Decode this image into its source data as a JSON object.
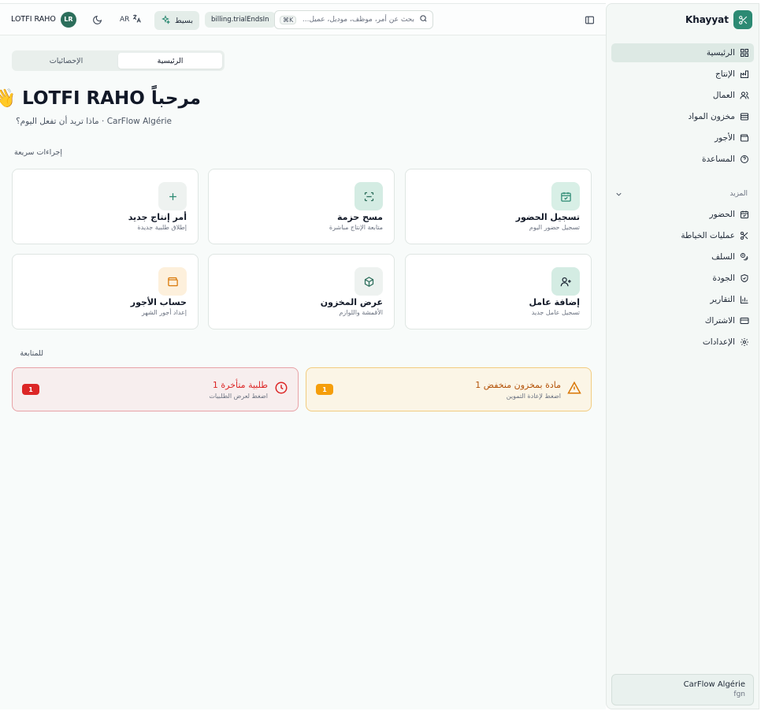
{
  "sidebar": {
    "brand": "Khayyat",
    "items": [
      {
        "label": "الرئيسية",
        "icon": "dashboard-icon",
        "active": true
      },
      {
        "label": "الإنتاج",
        "icon": "factory-icon"
      },
      {
        "label": "العمال",
        "icon": "users-icon"
      },
      {
        "label": "مخزون المواد",
        "icon": "layers-icon"
      },
      {
        "label": "الأجور",
        "icon": "wallet-icon"
      },
      {
        "label": "المساعدة",
        "icon": "help-icon"
      }
    ],
    "group_label": "المزيد",
    "more_items": [
      {
        "label": "الحضور",
        "icon": "calendar-check-icon"
      },
      {
        "label": "عمليات الخياطة",
        "icon": "scissors-icon"
      },
      {
        "label": "السلف",
        "icon": "money-icon"
      },
      {
        "label": "الجودة",
        "icon": "shield-icon"
      },
      {
        "label": "التقارير",
        "icon": "bar-chart-icon"
      },
      {
        "label": "الاشتراك",
        "icon": "credit-card-icon"
      },
      {
        "label": "الإعدادات",
        "icon": "settings-icon"
      }
    ],
    "org": {
      "name": "CarFlow Algérie",
      "sub": "fgn"
    }
  },
  "topbar": {
    "user_name": "LOTFI RAHO",
    "avatar_initials": "LR",
    "lang": "AR",
    "mode_label": "بسيط",
    "billing_label": "billing.trialEndsIn",
    "search_placeholder": "بحث عن أمر، موظف، موديل، عميل...",
    "search_kbd": "⌘K"
  },
  "tabs": [
    {
      "label": "الرئيسية",
      "active": true
    },
    {
      "label": "الإحصائيات",
      "active": false
    }
  ],
  "greeting": {
    "title": "مرحباً LOTFI RAHO 👋",
    "subtitle": "CarFlow Algérie · ماذا تريد أن تفعل اليوم؟"
  },
  "quick_actions": {
    "label": "إجراءات سريعة",
    "cards": [
      {
        "title": "تسجيل الحضور",
        "desc": "تسجيل حضور اليوم",
        "icon": "calendar-check-icon"
      },
      {
        "title": "مسح حزمة",
        "desc": "متابعة الإنتاج مباشرة",
        "icon": "scan-icon"
      },
      {
        "title": "أمر إنتاج جديد",
        "desc": "إطلاق طلبية جديدة",
        "icon": "plus-icon"
      },
      {
        "title": "إضافة عامل",
        "desc": "تسجيل عامل جديد",
        "icon": "user-plus-icon"
      },
      {
        "title": "عرض المخزون",
        "desc": "الأقمشة واللوازم",
        "icon": "package-icon"
      },
      {
        "title": "حساب الأجور",
        "desc": "إعداد أجور الشهر",
        "icon": "wallet-icon"
      }
    ]
  },
  "followup": {
    "label": "للمتابعة",
    "alerts": [
      {
        "title": "طلبية متأخرة 1",
        "desc": "اضغط لعرض الطلبيات",
        "count": "1",
        "icon": "clock-alert-icon",
        "color": "#dc2626"
      },
      {
        "title": "مادة بمخزون منخفض 1",
        "desc": "اضغط لإعادة التموين",
        "count": "1",
        "icon": "warning-icon",
        "color": "#f59e0b"
      }
    ]
  },
  "colors": {
    "primary": "#2c8a73",
    "danger": "#dc2626",
    "warning": "#f59e0b"
  }
}
